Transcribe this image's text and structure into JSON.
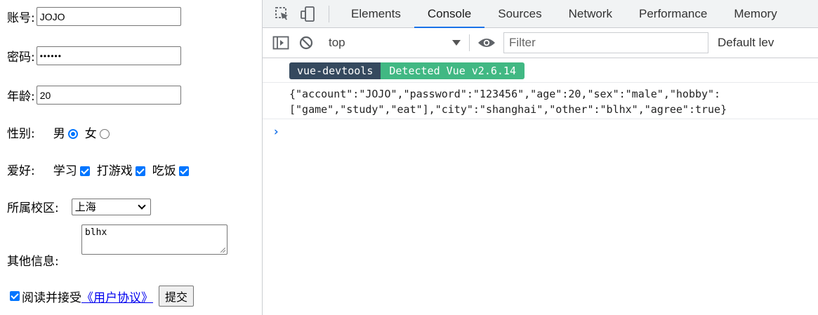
{
  "form": {
    "account_label": "账号:",
    "account_value": "JOJO",
    "password_label": "密码:",
    "password_value": "••••••",
    "age_label": "年龄:",
    "age_value": "20",
    "sex_label": "性别:",
    "sex_options": [
      {
        "label": "男",
        "checked": true
      },
      {
        "label": "女",
        "checked": false
      }
    ],
    "hobby_label": "爱好:",
    "hobby_options": [
      {
        "label": "学习",
        "checked": true
      },
      {
        "label": "打游戏",
        "checked": true
      },
      {
        "label": "吃饭",
        "checked": true
      }
    ],
    "city_label": "所属校区:",
    "city_value": "上海",
    "other_label": "其他信息:",
    "other_value": "blhx",
    "agree_text": "阅读并接受",
    "agree_link": "《用户协议》",
    "submit_label": "提交"
  },
  "devtools": {
    "tabs": [
      "Elements",
      "Console",
      "Sources",
      "Network",
      "Performance",
      "Memory"
    ],
    "active_tab": "Console",
    "context": "top",
    "filter_placeholder": "Filter",
    "levels_label": "Default lev",
    "badge_left": "vue-devtools",
    "badge_right": "Detected Vue v2.6.14",
    "log_output": "{\"account\":\"JOJO\",\"password\":\"123456\",\"age\":20,\"sex\":\"male\",\"hobby\":\n[\"game\",\"study\",\"eat\"],\"city\":\"shanghai\",\"other\":\"blhx\",\"agree\":true}",
    "prompt_symbol": "›"
  },
  "colors": {
    "accent": "#1a73e8",
    "vue_dark": "#35495e",
    "vue_green": "#41b883",
    "checkbox": "#0075ff"
  }
}
